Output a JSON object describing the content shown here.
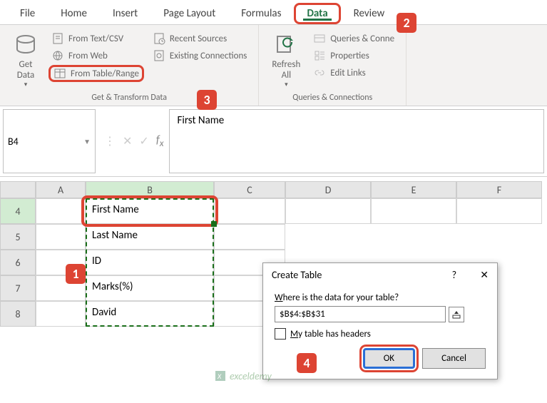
{
  "tabs": {
    "file": "File",
    "home": "Home",
    "insert": "Insert",
    "pagelayout": "Page Layout",
    "formulas": "Formulas",
    "data": "Data",
    "review": "Review"
  },
  "ribbon": {
    "getdata": "Get\nData",
    "from_text": "From Text/CSV",
    "from_web": "From Web",
    "from_table": "From Table/Range",
    "recent": "Recent Sources",
    "existing": "Existing Connections",
    "group1_label": "Get & Transform Data",
    "refresh": "Refresh\nAll",
    "queries": "Queries & Conne",
    "properties": "Properties",
    "editlinks": "Edit Links",
    "group2_label": "Queries & Connections"
  },
  "namebox": "B4",
  "formula_value": "First Name",
  "columns": [
    "A",
    "B",
    "C",
    "D",
    "E",
    "F"
  ],
  "rows": [
    "4",
    "5",
    "6",
    "7",
    "8"
  ],
  "cellsB": [
    "First Name",
    "Last Name",
    "ID",
    "Marks(%)",
    "David"
  ],
  "dialog": {
    "title": "Create Table",
    "help": "?",
    "close": "✕",
    "prompt_pre": "W",
    "prompt_mid": "here is the data for your table?",
    "range": "$B$4:$B$31",
    "checkbox_pre": "M",
    "checkbox_mid": "y table has headers",
    "ok": "OK",
    "cancel": "Cancel"
  },
  "callouts": {
    "c1": "1",
    "c2": "2",
    "c3": "3",
    "c4": "4"
  },
  "watermark": "exceldemy"
}
